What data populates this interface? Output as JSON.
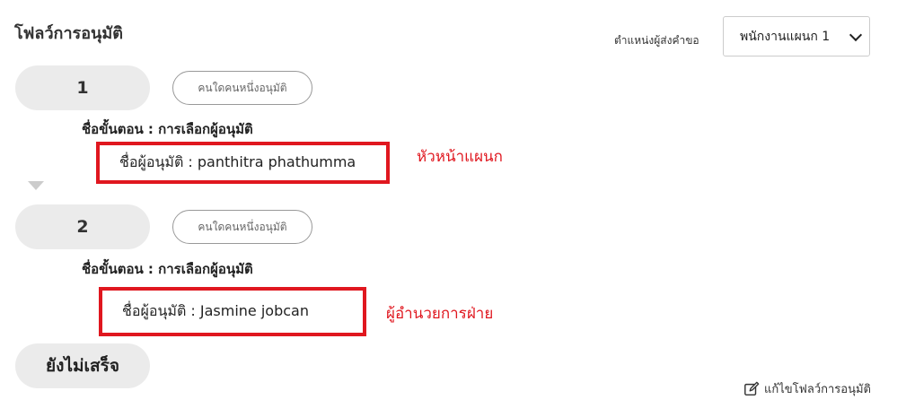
{
  "page": {
    "title": "โฟลว์การอนุมัติ"
  },
  "sender": {
    "label": "ตำแหน่งผู้ส่งคำขอ",
    "selected": "พนักงานแผนก 1"
  },
  "steps": [
    {
      "number": "1",
      "mode": "คนใดคนหนึ่งอนุมัติ",
      "step_name": "ชื่อขั้นตอน : การเลือกผู้อนุมัติ",
      "approver": "ชื่อผู้อนุมัติ : panthitra phathumma",
      "annotation": "หัวหน้าแผนก"
    },
    {
      "number": "2",
      "mode": "คนใดคนหนึ่งอนุมัติ",
      "step_name": "ชื่อขั้นตอน : การเลือกผู้อนุมัติ",
      "approver": "ชื่อผู้อนุมัติ : Jasmine jobcan",
      "annotation": "ผู้อำนวยการฝ่าย"
    }
  ],
  "status": {
    "label": "ยังไม่เสร็จ"
  },
  "edit": {
    "label": "แก้ไขโฟลว์การอนุมัติ",
    "icon": "edit-icon"
  },
  "colors": {
    "annotation": "#e0171f",
    "pill_bg": "#ebebeb"
  }
}
